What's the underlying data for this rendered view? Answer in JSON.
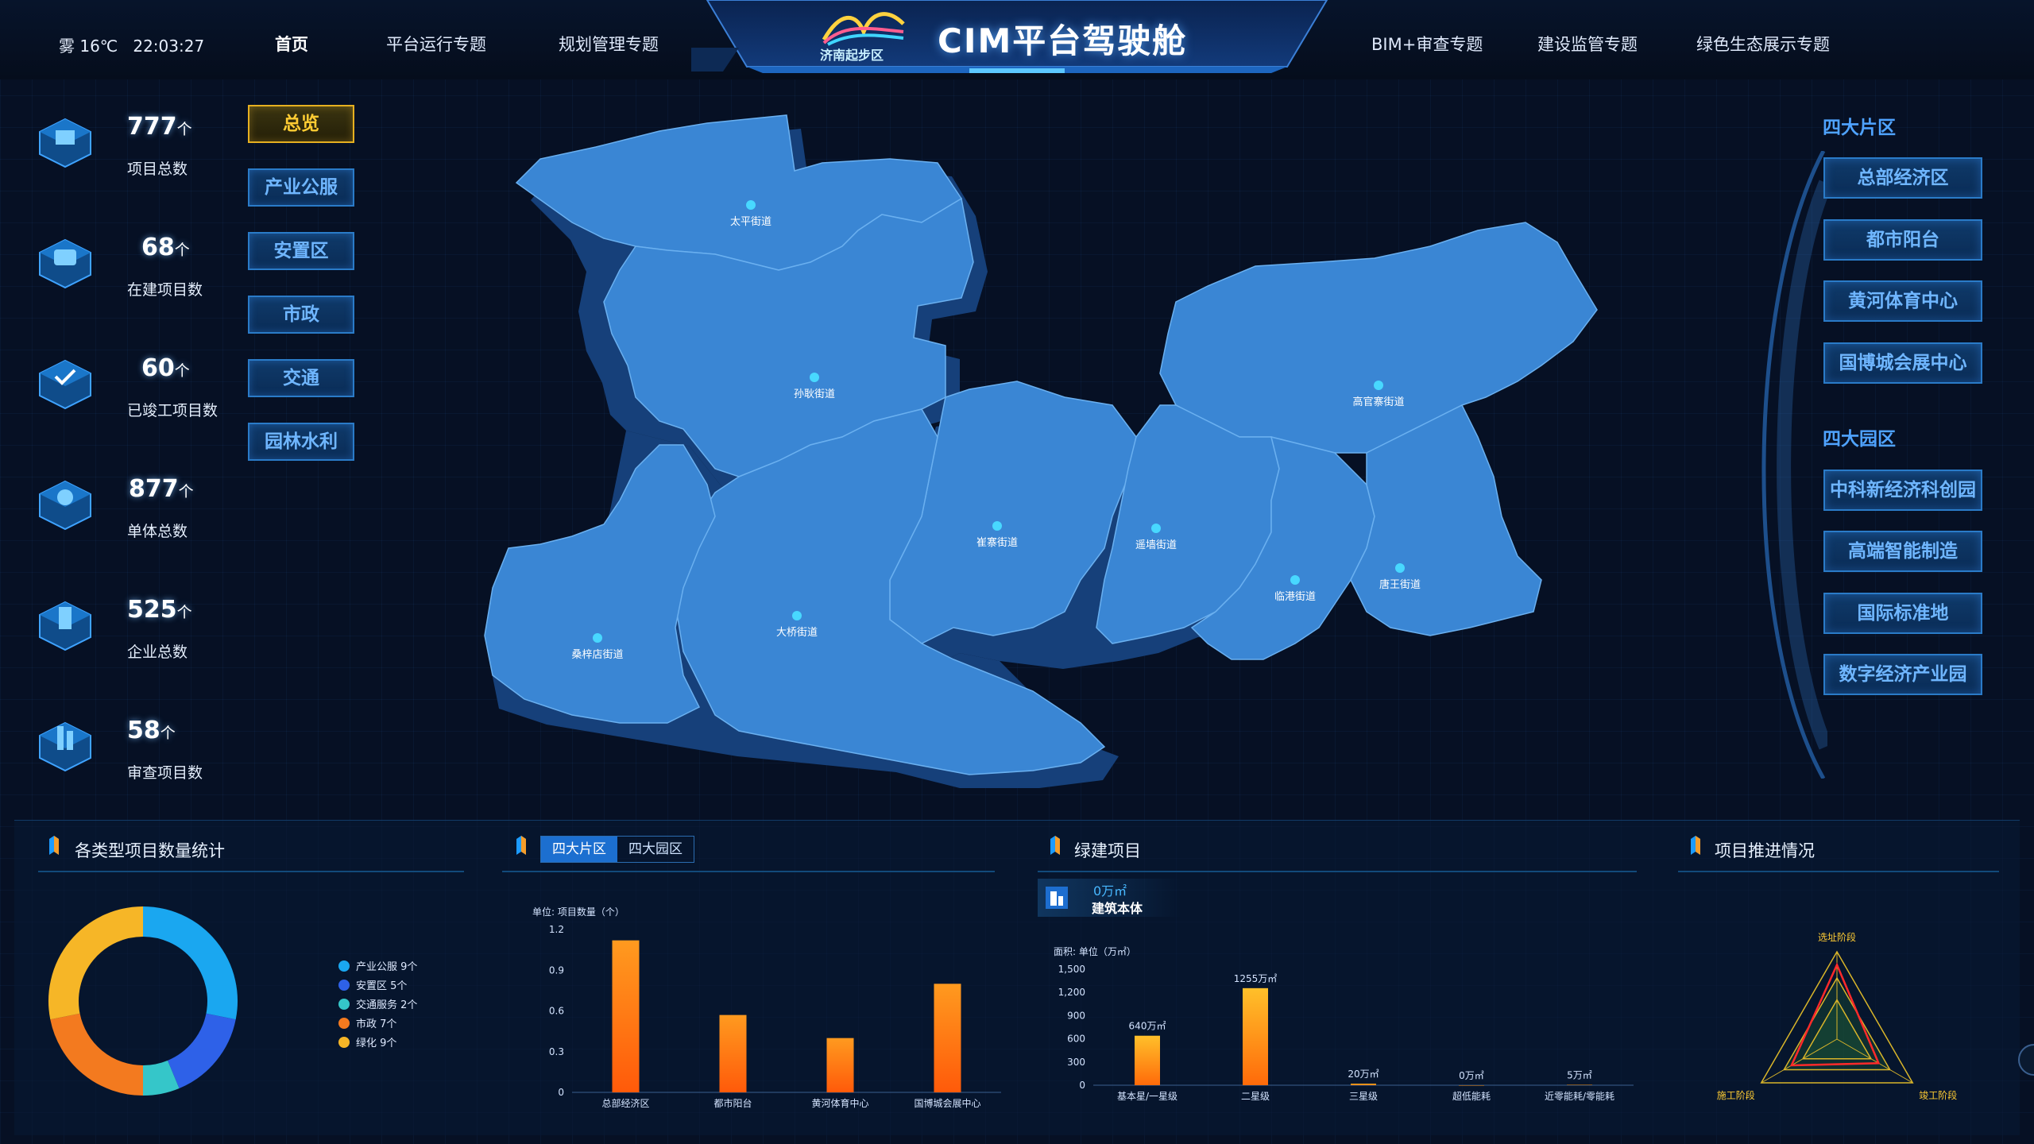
{
  "header": {
    "weather": "雾 16℃",
    "time": "22:03:27",
    "title": "CIM平台驾驶舱",
    "logo_text": "济南起步区",
    "nav_left": [
      "首页",
      "平台运行专题",
      "规划管理专题"
    ],
    "nav_right": [
      "BIM+审查专题",
      "建设监管专题",
      "绿色生态展示专题"
    ]
  },
  "stats": [
    {
      "value": "777",
      "unit": "个",
      "label": "项目总数",
      "icon": "projects-icon"
    },
    {
      "value": "68",
      "unit": "个",
      "label": "在建项目数",
      "icon": "construction-icon"
    },
    {
      "value": "60",
      "unit": "个",
      "label": "已竣工项目数",
      "icon": "completed-icon"
    },
    {
      "value": "877",
      "unit": "个",
      "label": "单体总数",
      "icon": "buildings-icon"
    },
    {
      "value": "525",
      "unit": "个",
      "label": "企业总数",
      "icon": "enterprise-icon"
    },
    {
      "value": "58",
      "unit": "个",
      "label": "审查项目数",
      "icon": "review-icon"
    }
  ],
  "filters": [
    "总览",
    "产业公服",
    "安置区",
    "市政",
    "交通",
    "园林水利"
  ],
  "map_labels": [
    "太平街道",
    "孙耿街道",
    "高官寨街道",
    "崔寨街道",
    "遥墙街道",
    "唐王街道",
    "临港街道",
    "大桥街道",
    "桑梓店街道"
  ],
  "right_panel": {
    "section1_title": "四大片区",
    "section1_items": [
      "总部经济区",
      "都市阳台",
      "黄河体育中心",
      "国博城会展中心"
    ],
    "section2_title": "四大园区",
    "section2_items": [
      "中科新经济科创园",
      "高端智能制造",
      "国际标准地",
      "数字经济产业园"
    ]
  },
  "panels": {
    "p1_title": "各类型项目数量统计",
    "p2_tabs": [
      "四大片区",
      "四大园区"
    ],
    "p3_title": "绿建项目",
    "p3_badge_value": "0万㎡",
    "p3_badge_label": "建筑本体",
    "p4_title": "项目推进情况"
  },
  "colors": {
    "accent": "#1c6fd0",
    "active_filter": "#ffcc33",
    "map_fill": "#3a86d4"
  },
  "chart_data": [
    {
      "type": "pie",
      "title": "",
      "categories": [
        "产业公服 9个",
        "安置区 5个",
        "交通服务 2个",
        "市政 7个",
        "绿化 9个"
      ],
      "values": [
        9,
        5,
        2,
        7,
        9
      ],
      "colors": [
        "#1aa7f0",
        "#2e61e8",
        "#35c6c9",
        "#f37a1f",
        "#f6b627"
      ]
    },
    {
      "type": "bar",
      "ylabel": "单位: 项目数量（个）",
      "categories": [
        "总部经济区",
        "都市阳台",
        "黄河体育中心",
        "国博城会展中心"
      ],
      "values": [
        1.12,
        0.57,
        0.4,
        0.8
      ],
      "yticks": [
        "0",
        "0.3",
        "0.6",
        "0.9",
        "1.2"
      ],
      "ylim": [
        0,
        1.2
      ]
    },
    {
      "type": "bar",
      "ylabel": "面积: 单位（万㎡）",
      "categories": [
        "基本星/一星级",
        "二星级",
        "三星级",
        "超低能耗",
        "近零能耗/零能耗"
      ],
      "values": [
        640,
        1255,
        20,
        0,
        5
      ],
      "data_labels": [
        "640万㎡",
        "1255万㎡",
        "20万㎡",
        "0万㎡",
        "5万㎡"
      ],
      "yticks": [
        "0",
        "300",
        "600",
        "900",
        "1,200",
        "1,500"
      ],
      "ylim": [
        0,
        1500
      ]
    },
    {
      "type": "radar",
      "axes": [
        "选址阶段",
        "竣工阶段",
        "施工阶段"
      ]
    }
  ]
}
